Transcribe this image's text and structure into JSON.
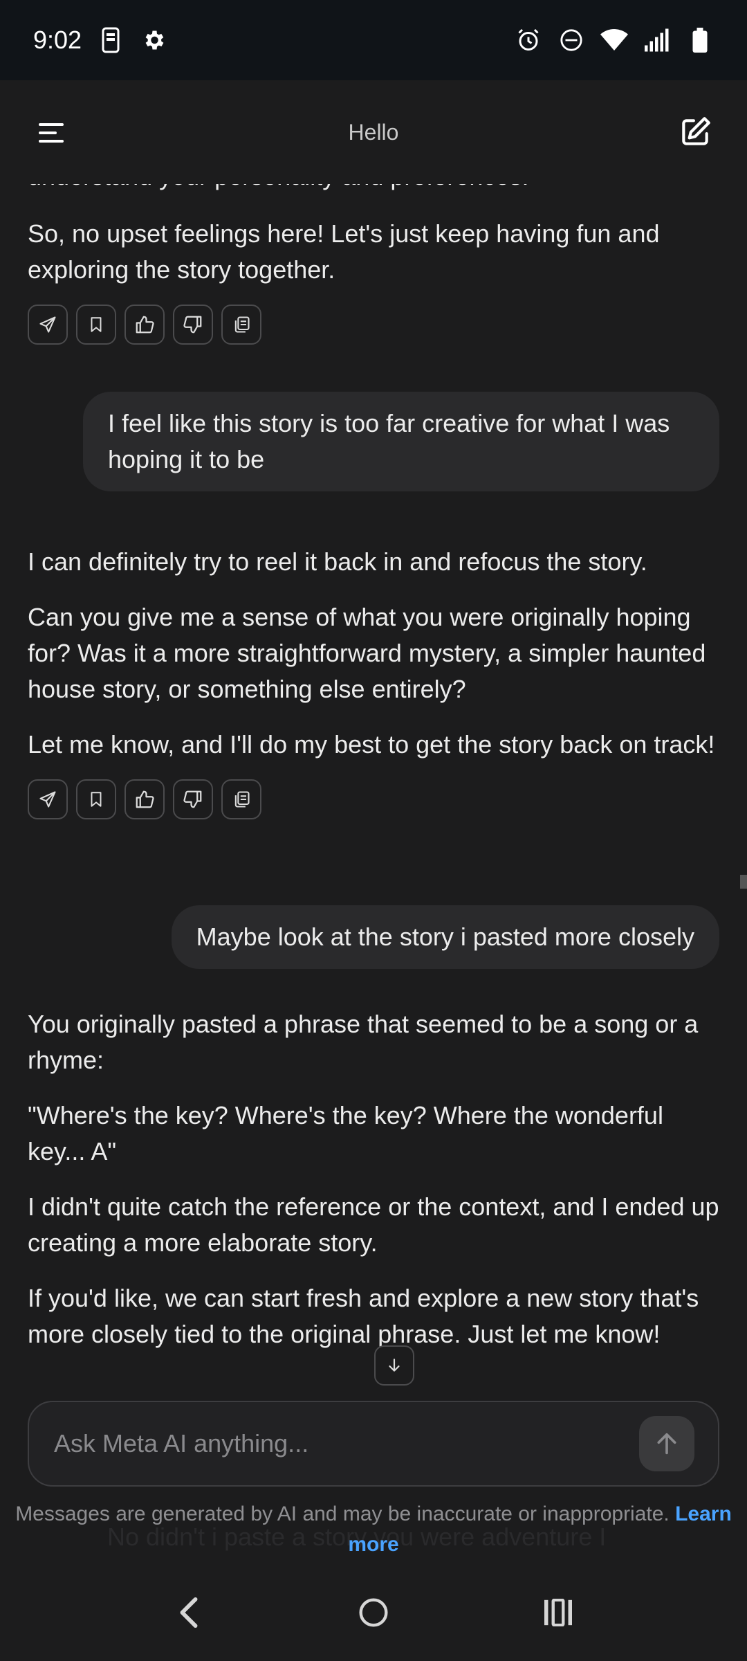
{
  "status_bar": {
    "time": "9:02",
    "left_icons": [
      "phone-icon",
      "gear-icon"
    ],
    "right_icons": [
      "alarm-icon",
      "do-not-disturb-icon",
      "wifi-icon",
      "signal-icon",
      "battery-icon"
    ]
  },
  "header": {
    "title": "Hello",
    "menu_icon": "menu-icon",
    "compose_icon": "new-chat-icon"
  },
  "messages": {
    "cut_line": "understand your personality and preferences.",
    "ai1": [
      "So, no upset feelings here! Let's just keep having fun and exploring the story together."
    ],
    "user1": "I feel like this story is too far creative for what I was hoping it to be",
    "ai2": [
      "I can definitely try to reel it back in and refocus the story.",
      "Can you give me a sense of what you were originally hoping for? Was it a more straightforward mystery, a simpler haunted house story, or something else entirely?",
      "Let me know, and I'll do my best to get the story back on track!"
    ],
    "user2": "Maybe look at the story i pasted more closely",
    "ai3": [
      "You originally pasted a phrase that seemed to be a song or a rhyme:",
      "\"Where's the key? Where's the key? Where the wonderful key... A\"",
      "I didn't quite catch the reference or the context, and I ended up creating a more elaborate story.",
      "If you'd like, we can start fresh and explore a new story that's more closely tied to the original phrase. Just let me know!"
    ],
    "actions": [
      "share-icon",
      "bookmark-icon",
      "thumbs-up-icon",
      "thumbs-down-icon",
      "copy-icon"
    ]
  },
  "composer": {
    "placeholder": "Ask Meta AI anything...",
    "send_icon": "send-arrow-icon"
  },
  "disclaimer": {
    "text": "Messages are generated by AI and may be inaccurate or inappropriate.",
    "link": "Learn more"
  },
  "ghost_text": "No didn't i paste a story you were adventure I",
  "nav": [
    "back-icon",
    "home-icon",
    "recents-icon"
  ]
}
